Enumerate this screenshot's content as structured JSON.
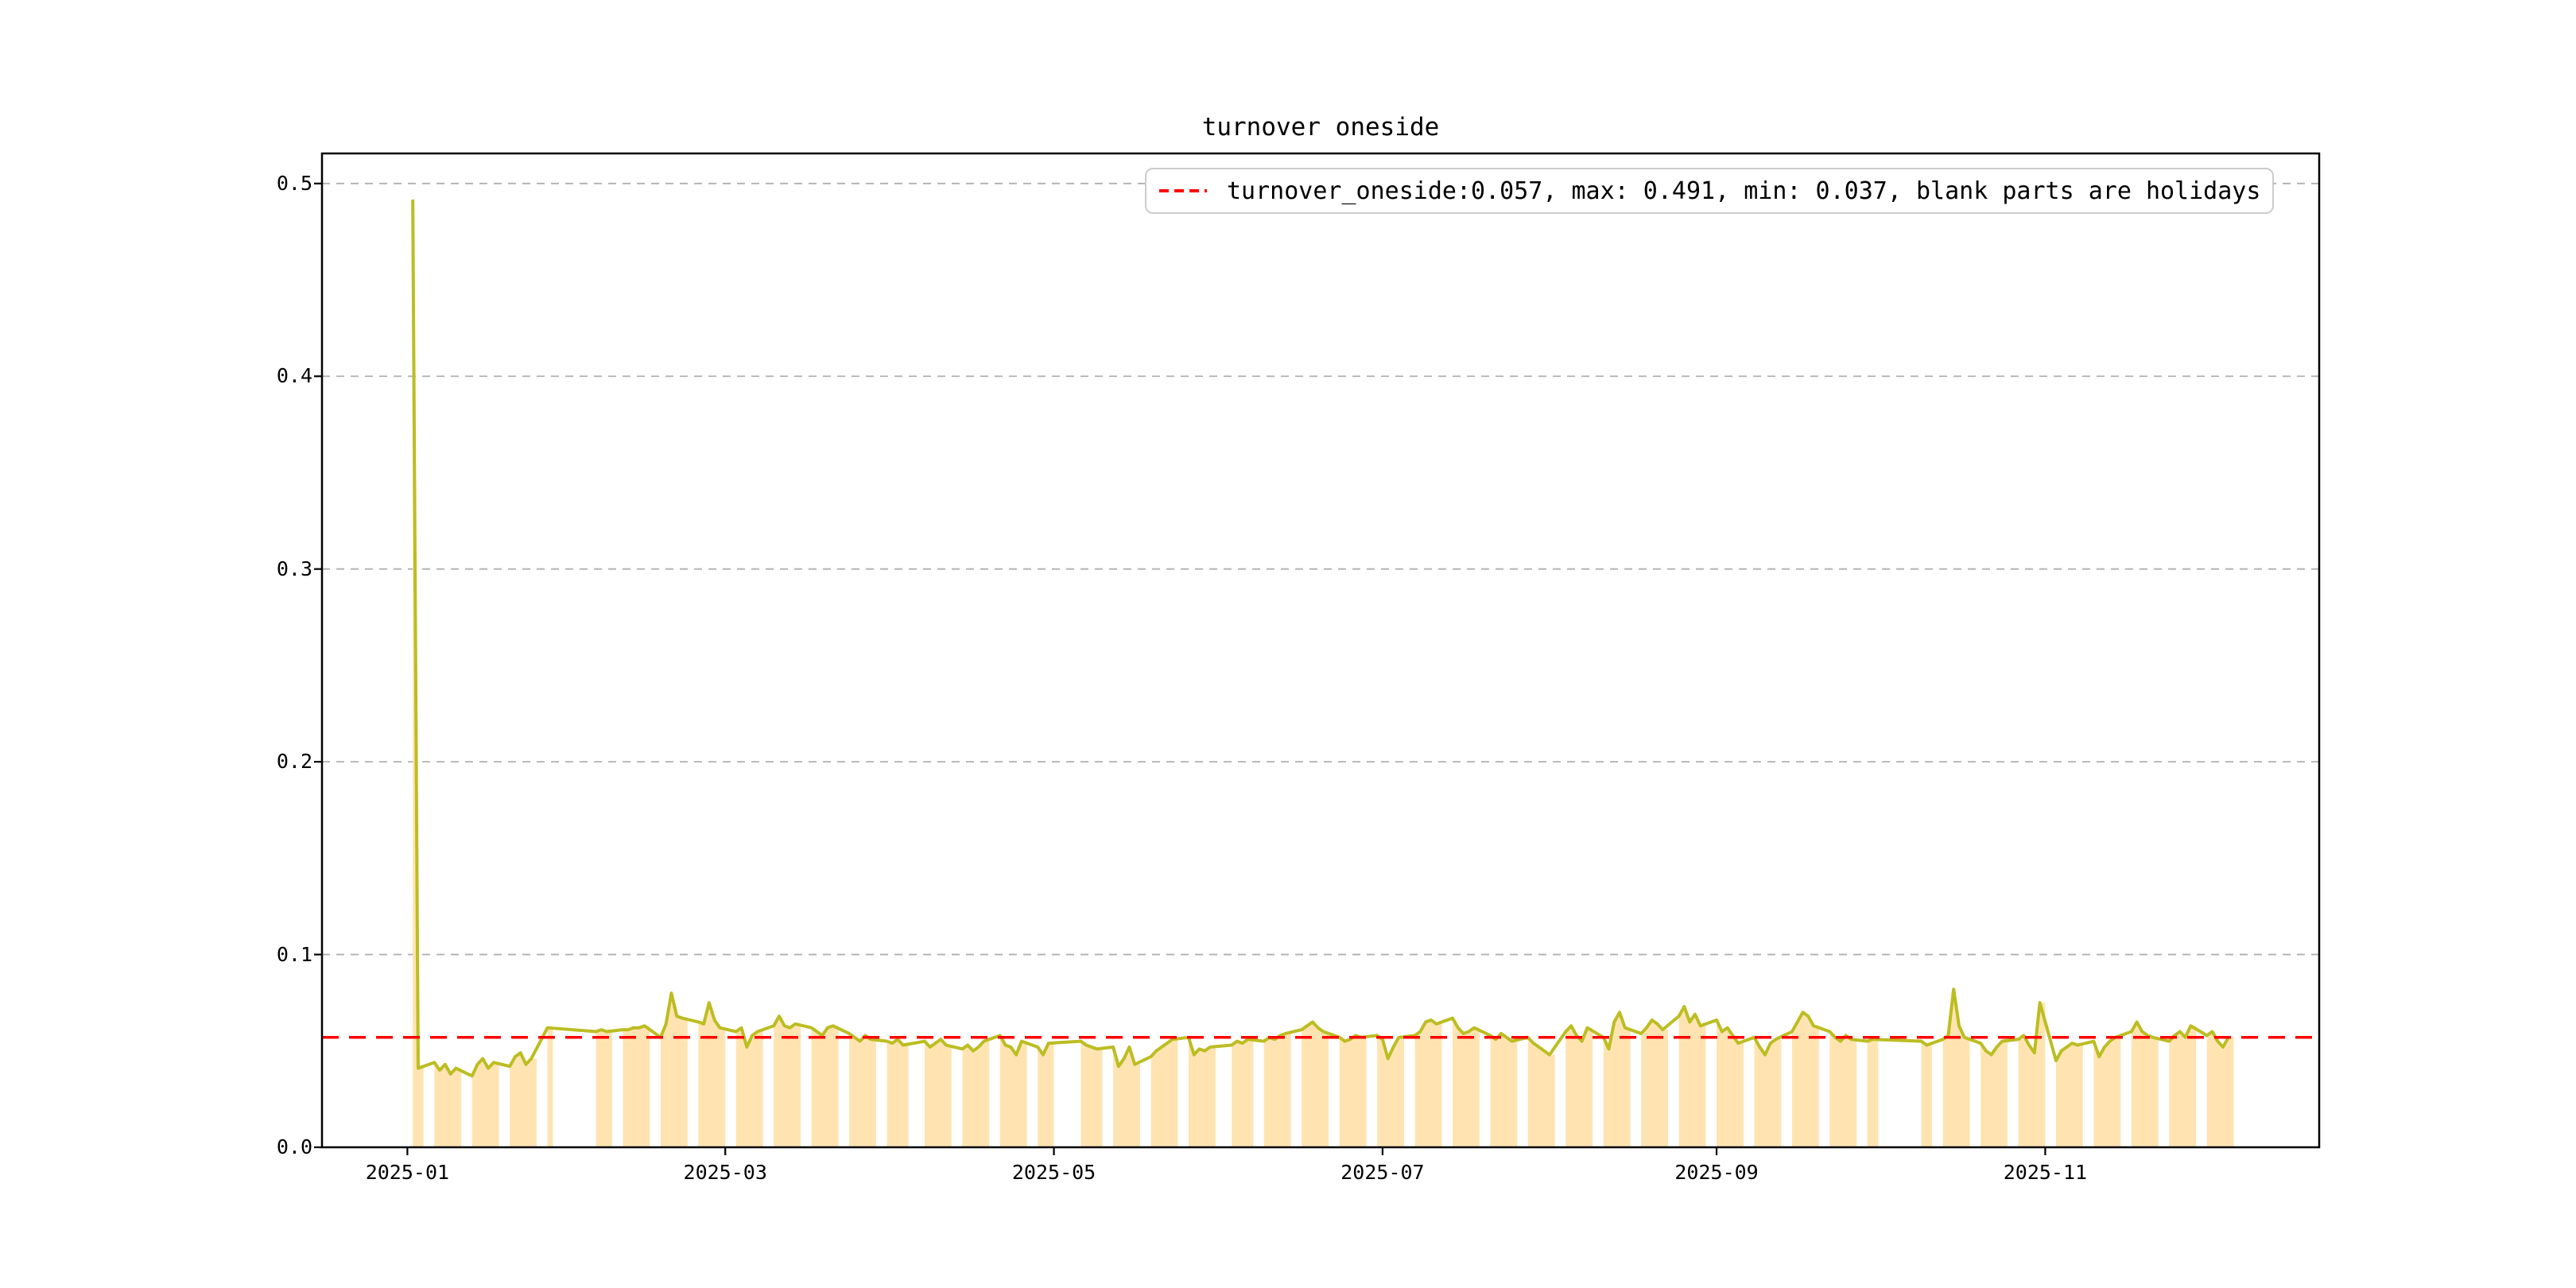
{
  "chart_data": {
    "type": "line",
    "title": "turnover oneside",
    "series_name": "turnover_oneside",
    "legend": {
      "label": "turnover_oneside:0.057, max: 0.491, min: 0.037, blank parts are holidays",
      "position": "upper right",
      "marker_style": "dashed",
      "marker_color": "#ff0000"
    },
    "stats": {
      "current": 0.057,
      "max": 0.491,
      "min": 0.037
    },
    "reference_line": {
      "value": 0.057,
      "color": "#ff0000",
      "style": "dashed"
    },
    "holidays_note": "blank parts are holidays",
    "grid": true,
    "ylim": [
      0,
      0.5156
    ],
    "xlim": [
      "2024-12-16",
      "2025-12-21"
    ],
    "y_ticks": [
      {
        "value": 0.0,
        "label": "0.0"
      },
      {
        "value": 0.1,
        "label": "0.1"
      },
      {
        "value": 0.2,
        "label": "0.2"
      },
      {
        "value": 0.3,
        "label": "0.3"
      },
      {
        "value": 0.4,
        "label": "0.4"
      },
      {
        "value": 0.5,
        "label": "0.5"
      }
    ],
    "x_ticks": [
      {
        "date": "2025-01-01",
        "label": "2025-01"
      },
      {
        "date": "2025-03-01",
        "label": "2025-03"
      },
      {
        "date": "2025-05-01",
        "label": "2025-05"
      },
      {
        "date": "2025-07-01",
        "label": "2025-07"
      },
      {
        "date": "2025-09-01",
        "label": "2025-09"
      },
      {
        "date": "2025-11-01",
        "label": "2025-11"
      }
    ],
    "colors": {
      "line": "#bcbd22",
      "fill": "#ffe4b2",
      "grid": "#b0b0b0",
      "reference": "#ff0000",
      "border": "#000000"
    },
    "dates": [
      "2025-01-02",
      "2025-01-03",
      "2025-01-06",
      "2025-01-07",
      "2025-01-08",
      "2025-01-09",
      "2025-01-10",
      "2025-01-13",
      "2025-01-14",
      "2025-01-15",
      "2025-01-16",
      "2025-01-17",
      "2025-01-20",
      "2025-01-21",
      "2025-01-22",
      "2025-01-23",
      "2025-01-24",
      "2025-01-27",
      "2025-02-05",
      "2025-02-06",
      "2025-02-07",
      "2025-02-10",
      "2025-02-11",
      "2025-02-12",
      "2025-02-13",
      "2025-02-14",
      "2025-02-17",
      "2025-02-18",
      "2025-02-19",
      "2025-02-20",
      "2025-02-21",
      "2025-02-24",
      "2025-02-25",
      "2025-02-26",
      "2025-02-27",
      "2025-02-28",
      "2025-03-03",
      "2025-03-04",
      "2025-03-05",
      "2025-03-06",
      "2025-03-07",
      "2025-03-10",
      "2025-03-11",
      "2025-03-12",
      "2025-03-13",
      "2025-03-14",
      "2025-03-17",
      "2025-03-18",
      "2025-03-19",
      "2025-03-20",
      "2025-03-21",
      "2025-03-24",
      "2025-03-25",
      "2025-03-26",
      "2025-03-27",
      "2025-03-28",
      "2025-03-31",
      "2025-04-01",
      "2025-04-02",
      "2025-04-03",
      "2025-04-07",
      "2025-04-08",
      "2025-04-09",
      "2025-04-10",
      "2025-04-11",
      "2025-04-14",
      "2025-04-15",
      "2025-04-16",
      "2025-04-17",
      "2025-04-18",
      "2025-04-21",
      "2025-04-22",
      "2025-04-23",
      "2025-04-24",
      "2025-04-25",
      "2025-04-28",
      "2025-04-29",
      "2025-04-30",
      "2025-05-06",
      "2025-05-07",
      "2025-05-08",
      "2025-05-09",
      "2025-05-12",
      "2025-05-13",
      "2025-05-14",
      "2025-05-15",
      "2025-05-16",
      "2025-05-19",
      "2025-05-20",
      "2025-05-21",
      "2025-05-22",
      "2025-05-23",
      "2025-05-26",
      "2025-05-27",
      "2025-05-28",
      "2025-05-29",
      "2025-05-30",
      "2025-06-03",
      "2025-06-04",
      "2025-06-05",
      "2025-06-06",
      "2025-06-09",
      "2025-06-10",
      "2025-06-11",
      "2025-06-12",
      "2025-06-13",
      "2025-06-16",
      "2025-06-17",
      "2025-06-18",
      "2025-06-19",
      "2025-06-20",
      "2025-06-23",
      "2025-06-24",
      "2025-06-25",
      "2025-06-26",
      "2025-06-27",
      "2025-06-30",
      "2025-07-01",
      "2025-07-02",
      "2025-07-03",
      "2025-07-04",
      "2025-07-07",
      "2025-07-08",
      "2025-07-09",
      "2025-07-10",
      "2025-07-11",
      "2025-07-14",
      "2025-07-15",
      "2025-07-16",
      "2025-07-17",
      "2025-07-18",
      "2025-07-21",
      "2025-07-22",
      "2025-07-23",
      "2025-07-24",
      "2025-07-25",
      "2025-07-28",
      "2025-07-29",
      "2025-07-30",
      "2025-07-31",
      "2025-08-01",
      "2025-08-04",
      "2025-08-05",
      "2025-08-06",
      "2025-08-07",
      "2025-08-08",
      "2025-08-11",
      "2025-08-12",
      "2025-08-13",
      "2025-08-14",
      "2025-08-15",
      "2025-08-18",
      "2025-08-19",
      "2025-08-20",
      "2025-08-21",
      "2025-08-22",
      "2025-08-25",
      "2025-08-26",
      "2025-08-27",
      "2025-08-28",
      "2025-08-29",
      "2025-09-01",
      "2025-09-02",
      "2025-09-03",
      "2025-09-04",
      "2025-09-05",
      "2025-09-08",
      "2025-09-09",
      "2025-09-10",
      "2025-09-11",
      "2025-09-12",
      "2025-09-15",
      "2025-09-16",
      "2025-09-17",
      "2025-09-18",
      "2025-09-19",
      "2025-09-22",
      "2025-09-23",
      "2025-09-24",
      "2025-09-25",
      "2025-09-26",
      "2025-09-29",
      "2025-09-30",
      "2025-10-09",
      "2025-10-10",
      "2025-10-13",
      "2025-10-14",
      "2025-10-15",
      "2025-10-16",
      "2025-10-17",
      "2025-10-20",
      "2025-10-21",
      "2025-10-22",
      "2025-10-23",
      "2025-10-24",
      "2025-10-27",
      "2025-10-28",
      "2025-10-29",
      "2025-10-30",
      "2025-10-31",
      "2025-11-03",
      "2025-11-04",
      "2025-11-05",
      "2025-11-06",
      "2025-11-07",
      "2025-11-10",
      "2025-11-11",
      "2025-11-12",
      "2025-11-13",
      "2025-11-14",
      "2025-11-17",
      "2025-11-18",
      "2025-11-19",
      "2025-11-20",
      "2025-11-21",
      "2025-11-24",
      "2025-11-25",
      "2025-11-26",
      "2025-11-27",
      "2025-11-28",
      "2025-12-01",
      "2025-12-02",
      "2025-12-03",
      "2025-12-04",
      "2025-12-05"
    ],
    "values": [
      0.491,
      0.041,
      0.044,
      0.04,
      0.043,
      0.038,
      0.041,
      0.037,
      0.043,
      0.046,
      0.041,
      0.044,
      0.042,
      0.047,
      0.049,
      0.043,
      0.046,
      0.062,
      0.06,
      0.061,
      0.06,
      0.061,
      0.061,
      0.062,
      0.062,
      0.063,
      0.057,
      0.064,
      0.08,
      0.068,
      0.067,
      0.065,
      0.064,
      0.075,
      0.066,
      0.062,
      0.06,
      0.062,
      0.052,
      0.058,
      0.06,
      0.063,
      0.068,
      0.063,
      0.062,
      0.064,
      0.062,
      0.06,
      0.058,
      0.062,
      0.063,
      0.059,
      0.057,
      0.055,
      0.058,
      0.056,
      0.055,
      0.054,
      0.056,
      0.053,
      0.055,
      0.052,
      0.054,
      0.056,
      0.053,
      0.051,
      0.053,
      0.05,
      0.052,
      0.055,
      0.058,
      0.053,
      0.052,
      0.048,
      0.055,
      0.052,
      0.048,
      0.054,
      0.055,
      0.053,
      0.052,
      0.051,
      0.052,
      0.042,
      0.046,
      0.052,
      0.043,
      0.047,
      0.05,
      0.052,
      0.054,
      0.056,
      0.057,
      0.048,
      0.051,
      0.05,
      0.052,
      0.053,
      0.055,
      0.054,
      0.056,
      0.055,
      0.057,
      0.056,
      0.058,
      0.059,
      0.061,
      0.063,
      0.065,
      0.062,
      0.06,
      0.057,
      0.055,
      0.056,
      0.058,
      0.057,
      0.058,
      0.056,
      0.046,
      0.052,
      0.057,
      0.058,
      0.06,
      0.065,
      0.066,
      0.064,
      0.067,
      0.062,
      0.059,
      0.06,
      0.062,
      0.058,
      0.056,
      0.059,
      0.057,
      0.055,
      0.057,
      0.054,
      0.052,
      0.05,
      0.048,
      0.06,
      0.063,
      0.058,
      0.055,
      0.062,
      0.057,
      0.051,
      0.065,
      0.07,
      0.062,
      0.059,
      0.062,
      0.066,
      0.064,
      0.061,
      0.068,
      0.073,
      0.065,
      0.069,
      0.063,
      0.066,
      0.06,
      0.062,
      0.058,
      0.054,
      0.057,
      0.052,
      0.048,
      0.054,
      0.056,
      0.06,
      0.065,
      0.07,
      0.068,
      0.063,
      0.06,
      0.057,
      0.055,
      0.058,
      0.056,
      0.055,
      0.056,
      0.055,
      0.053,
      0.056,
      0.058,
      0.082,
      0.063,
      0.057,
      0.054,
      0.05,
      0.048,
      0.052,
      0.055,
      0.056,
      0.058,
      0.053,
      0.049,
      0.075,
      0.045,
      0.05,
      0.052,
      0.054,
      0.053,
      0.055,
      0.047,
      0.052,
      0.055,
      0.057,
      0.06,
      0.065,
      0.06,
      0.058,
      0.057,
      0.055,
      0.058,
      0.06,
      0.057,
      0.063,
      0.058,
      0.06,
      0.055,
      0.052,
      0.057
    ]
  }
}
